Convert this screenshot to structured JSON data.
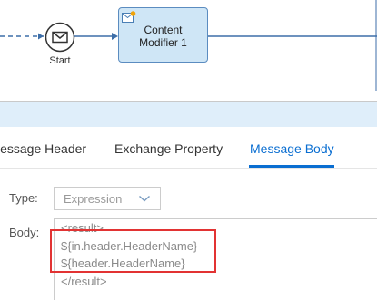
{
  "flow": {
    "start_label": "Start",
    "content_modifier_label_line1": "Content",
    "content_modifier_label_line2": "Modifier 1"
  },
  "tabs": [
    {
      "label": "lessage Header",
      "active": false
    },
    {
      "label": "Exchange Property",
      "active": false
    },
    {
      "label": "Message Body",
      "active": true
    }
  ],
  "form": {
    "type_label": "Type:",
    "type_value": "Expression",
    "body_label": "Body:",
    "body_lines": [
      "<result>",
      "${in.header.HeaderName}",
      "${header.HeaderName}",
      "</result>"
    ]
  },
  "colors": {
    "accent": "#0a6ed1",
    "highlight_border": "#e23333",
    "step_fill": "#cfe6f6",
    "step_border": "#5b8cc0",
    "connector": "#3d6ea8"
  }
}
